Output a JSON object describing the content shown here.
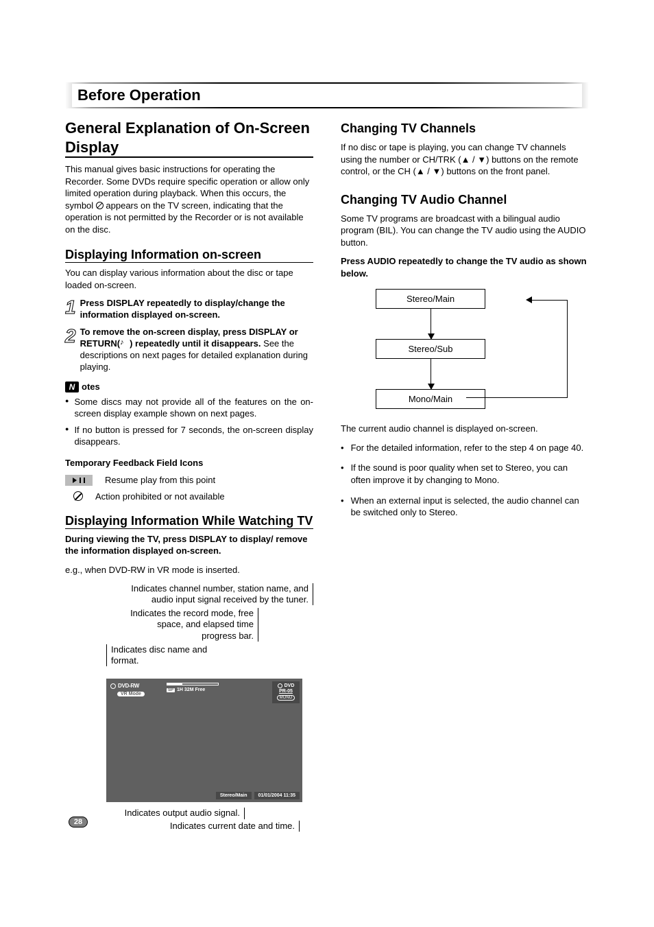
{
  "section_title": "Before Operation",
  "page_number": "28",
  "left": {
    "major_heading": "General Explanation of On-Screen Display",
    "intro": "This manual gives basic instructions for operating the Recorder. Some DVDs require specific operation or allow only limited operation during playback. When this occurs, the symbol ",
    "intro2": " appears on the TV screen, indicating that the operation is not permitted by the Recorder or is not available on the disc.",
    "disp_heading": "Displaying Information on-screen",
    "disp_intro": "You can display various information about the disc or tape loaded on-screen.",
    "step1": "Press DISPLAY repeatedly to display/change the information displayed on-screen.",
    "step2_bold": "To remove the on-screen display, press DISPLAY or RETURN(",
    "step2_bold_end": ") repeatedly until it disappears.",
    "step2_rest": "See the descriptions on next pages for detailed explanation during playing.",
    "notes_label": "otes",
    "notes_icon_letter": "N",
    "note1": "Some discs may not provide all of the features on the on-screen display example shown on next pages.",
    "note2": "If no button is pressed for 7 seconds, the on-screen display disappears.",
    "temp_heading": "Temporary Feedback Field Icons",
    "resume_label": "Resume play from this point",
    "prohib_label": "Action prohibited or not available",
    "tv_heading": "Displaying Information While Watching TV",
    "tv_bold": "During viewing the TV, press DISPLAY to display/ remove the information displayed on-screen.",
    "tv_eg": "e.g., when DVD-RW in VR mode is inserted.",
    "callout1": "Indicates channel number, station name, and audio input signal received by the tuner.",
    "callout2": "Indicates the record mode, free space, and elapsed time progress bar.",
    "callout3": "Indicates disc name and format.",
    "callout4": "Indicates output audio signal.",
    "callout5": "Indicates current date and time.",
    "osd": {
      "disc": "DVD-RW",
      "vr": "VR Mode",
      "sp": "SP",
      "free": "1H 32M Free",
      "dvd": "DVD",
      "pr": "PR-05",
      "mono": "MONO",
      "stereo": "Stereo/Main",
      "datetime": "01/01/2004 11:35"
    }
  },
  "right": {
    "ch_heading": "Changing TV Channels",
    "ch_body": "If no disc or tape is playing, you can change TV channels using the number or CH/TRK (▲ / ▼) buttons on the remote control, or the CH (▲ / ▼) buttons on the front panel.",
    "aud_heading": "Changing TV Audio Channel",
    "aud_body": "Some TV programs are broadcast with a bilingual audio program (BIL). You can change the TV audio using the AUDIO button.",
    "aud_bold": "Press AUDIO repeatedly to change the TV audio as shown below.",
    "diag1": "Stereo/Main",
    "diag2": "Stereo/Sub",
    "diag3": "Mono/Main",
    "after": "The current audio channel is displayed on-screen.",
    "b1": "For the detailed information, refer to the step 4 on page 40.",
    "b2": "If the sound is poor quality when set to Stereo, you can often improve it by changing to Mono.",
    "b3": "When an external input is selected, the audio channel can be switched only to Stereo."
  }
}
